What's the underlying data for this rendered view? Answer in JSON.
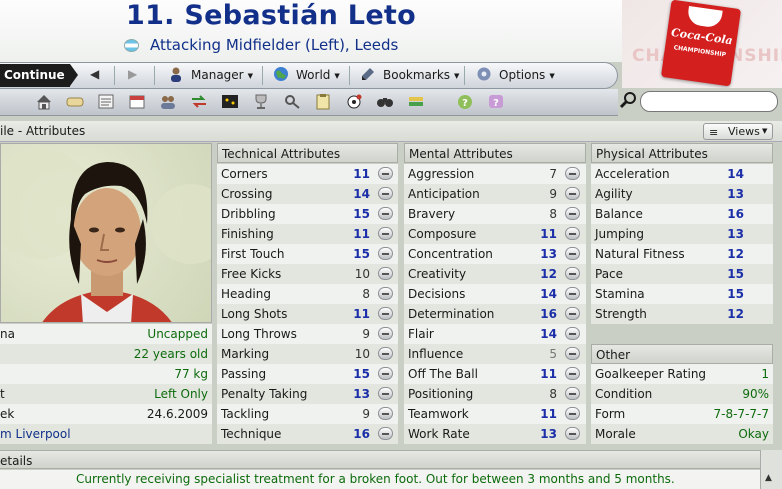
{
  "header": {
    "title": "11. Sebastián Leto",
    "subtitle": "Attacking Midfielder (Left), Leeds",
    "sponsor_text": "Coca-Cola",
    "sponsor_sub": "CHAMPIONSHIP",
    "sponsor_bg": "CHAMPIONSHIP"
  },
  "nav": {
    "continue": "Continue",
    "manager": "Manager",
    "world": "World",
    "bookmarks": "Bookmarks",
    "options": "Options"
  },
  "panel": {
    "title": "ile - Attributes",
    "views": "Views"
  },
  "info": [
    {
      "label": "na",
      "value": "Uncapped"
    },
    {
      "label": "",
      "value": "22 years old"
    },
    {
      "label": "",
      "value": "77 kg"
    },
    {
      "label": "t",
      "value": "Left Only"
    },
    {
      "label": "ek",
      "value": "24.6.2009"
    },
    {
      "label": "m Liverpool",
      "value": ""
    }
  ],
  "technical": {
    "heading": "Technical Attributes",
    "rows": [
      {
        "name": "Corners",
        "value": "11"
      },
      {
        "name": "Crossing",
        "value": "14"
      },
      {
        "name": "Dribbling",
        "value": "15"
      },
      {
        "name": "Finishing",
        "value": "11"
      },
      {
        "name": "First Touch",
        "value": "15"
      },
      {
        "name": "Free Kicks",
        "value": "10"
      },
      {
        "name": "Heading",
        "value": "8"
      },
      {
        "name": "Long Shots",
        "value": "11"
      },
      {
        "name": "Long Throws",
        "value": "9"
      },
      {
        "name": "Marking",
        "value": "10"
      },
      {
        "name": "Passing",
        "value": "15"
      },
      {
        "name": "Penalty Taking",
        "value": "13"
      },
      {
        "name": "Tackling",
        "value": "9"
      },
      {
        "name": "Technique",
        "value": "16"
      }
    ]
  },
  "mental": {
    "heading": "Mental Attributes",
    "rows": [
      {
        "name": "Aggression",
        "value": "7"
      },
      {
        "name": "Anticipation",
        "value": "9"
      },
      {
        "name": "Bravery",
        "value": "8"
      },
      {
        "name": "Composure",
        "value": "11"
      },
      {
        "name": "Concentration",
        "value": "13"
      },
      {
        "name": "Creativity",
        "value": "12"
      },
      {
        "name": "Decisions",
        "value": "14"
      },
      {
        "name": "Determination",
        "value": "16"
      },
      {
        "name": "Flair",
        "value": "14"
      },
      {
        "name": "Influence",
        "value": "5"
      },
      {
        "name": "Off The Ball",
        "value": "11"
      },
      {
        "name": "Positioning",
        "value": "8"
      },
      {
        "name": "Teamwork",
        "value": "11"
      },
      {
        "name": "Work Rate",
        "value": "13"
      }
    ]
  },
  "physical": {
    "heading": "Physical Attributes",
    "rows": [
      {
        "name": "Acceleration",
        "value": "14"
      },
      {
        "name": "Agility",
        "value": "13"
      },
      {
        "name": "Balance",
        "value": "16"
      },
      {
        "name": "Jumping",
        "value": "13"
      },
      {
        "name": "Natural Fitness",
        "value": "12"
      },
      {
        "name": "Pace",
        "value": "15"
      },
      {
        "name": "Stamina",
        "value": "15"
      },
      {
        "name": "Strength",
        "value": "12"
      }
    ]
  },
  "other": {
    "heading": "Other",
    "rows": [
      {
        "name": "Goalkeeper Rating",
        "value": "1"
      },
      {
        "name": "Condition",
        "value": "90%"
      },
      {
        "name": "Form",
        "value": "7-8-7-7-7"
      },
      {
        "name": "Morale",
        "value": "Okay"
      }
    ]
  },
  "details": {
    "title": "etails",
    "status": "Currently receiving specialist treatment for a broken foot. Out for between 3 months and 5 months."
  },
  "colors": {
    "title_blue": "#12308a",
    "value_blue": "#1b2fa8",
    "value_green": "#0d6b0d",
    "sponsor_red": "#d41f1f"
  },
  "icons": [
    "home-icon",
    "inbox-icon",
    "news-icon",
    "calendar-icon",
    "squad-icon",
    "transfer-icon",
    "tactics-icon",
    "trophy-icon",
    "scouting-icon",
    "clipboard-icon",
    "match-icon",
    "binoculars-icon",
    "finance-icon",
    "help-icon",
    "hint-icon",
    "search-icon"
  ]
}
